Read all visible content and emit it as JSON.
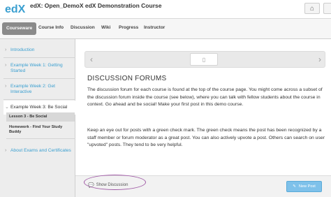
{
  "header": {
    "logo": "edX",
    "course_title": "edX: Open_DemoX edX Demonstration Course"
  },
  "nav": {
    "tabs": [
      "Courseware",
      "Course Info",
      "Discussion",
      "Wiki",
      "Progress",
      "Instructor"
    ],
    "active": "Courseware"
  },
  "sidebar": {
    "items": [
      {
        "label": "Introduction"
      },
      {
        "label": "Example Week 1: Getting Started"
      },
      {
        "label": "Example Week 2: Get Interactive"
      },
      {
        "label": "Example Week 3: Be Social"
      },
      {
        "label": "About Exams and Certificates"
      }
    ],
    "subitems": [
      {
        "label": "Lesson 3 - Be Social"
      },
      {
        "label": "Homework - Find Your Study Buddy"
      }
    ]
  },
  "main": {
    "section_title": "DISCUSSION FORUMS",
    "paragraph1": "The discussion forum for each course is found at the top of the course page. You might come across a subset of the discussion forum inside the course (see below), where you can talk with fellow students about the course in context.  Go ahead and be social! Make your first post in this demo course.",
    "paragraph2": "Keep an eye out for posts with a green check mark.  The green check  means the post has been recognized by a staff member or forum moderator as a great post. You can also actively upvote a post. Others can search on user \"upvoted\" posts.  They tend to be very helpful.",
    "show_discussion": "Show Discussion",
    "new_post": "New Post"
  },
  "colors": {
    "link": "#3a9fd0",
    "active_tab": "#8a8a8a",
    "new_post": "#7ec1ea",
    "highlight_ring": "#a05aa6"
  }
}
